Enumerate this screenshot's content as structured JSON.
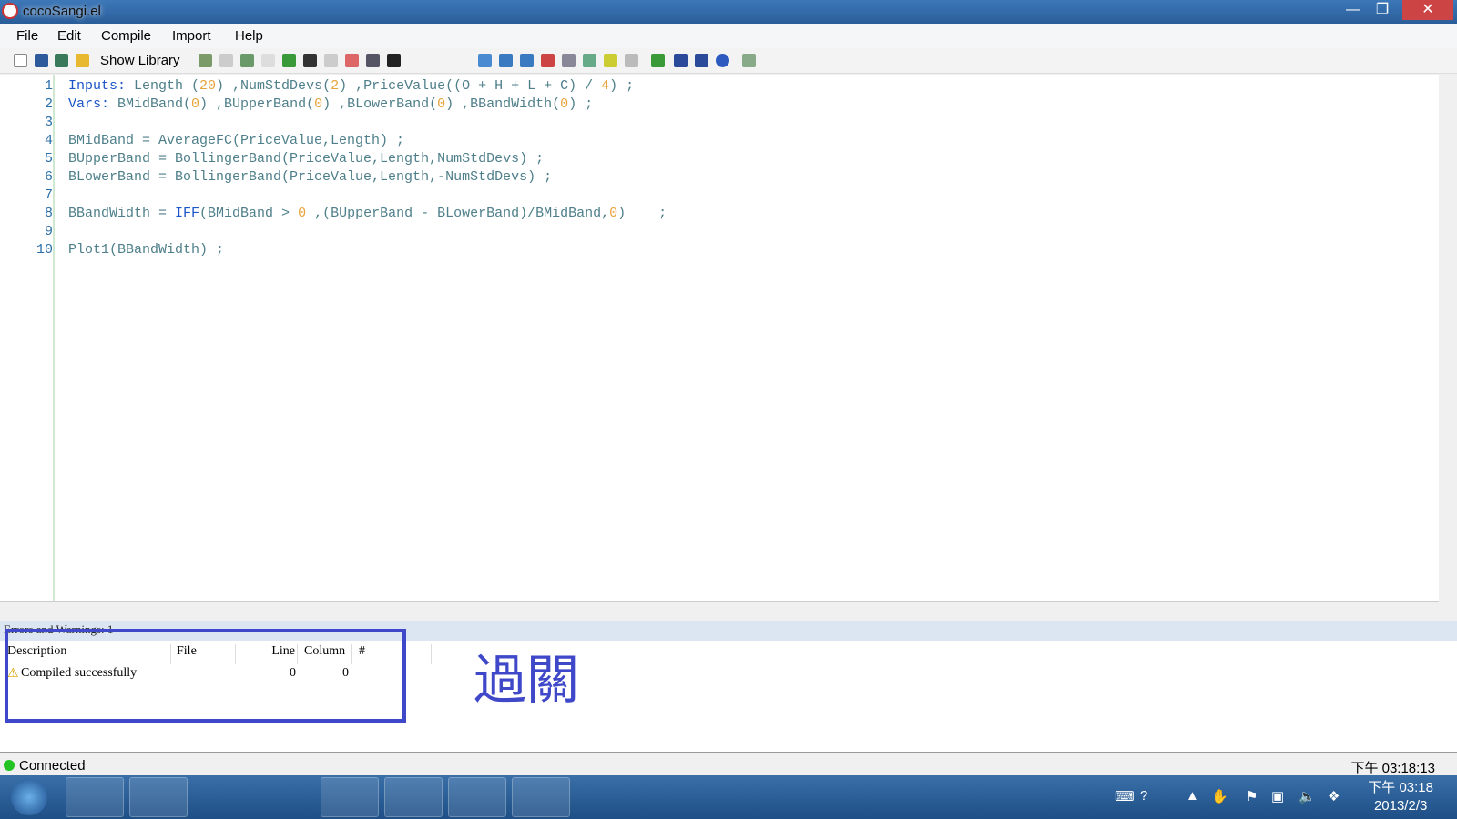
{
  "window": {
    "title": "cocoSangi.el"
  },
  "menu": [
    "File",
    "Edit",
    "Compile",
    "Import",
    "Help"
  ],
  "toolbar": {
    "show_library": "Show Library"
  },
  "code": [
    {
      "num": "1",
      "tokens": [
        [
          "k",
          "Inputs:"
        ],
        [
          "p",
          " Length ("
        ],
        [
          "n",
          "20"
        ],
        [
          "p",
          ") ,NumStdDevs("
        ],
        [
          "n",
          "2"
        ],
        [
          "p",
          ") ,PriceValue((O + H + L + C) / "
        ],
        [
          "n",
          "4"
        ],
        [
          "p",
          ") ;"
        ]
      ]
    },
    {
      "num": "2",
      "tokens": [
        [
          "k",
          "Vars:"
        ],
        [
          "p",
          " BMidBand("
        ],
        [
          "n",
          "0"
        ],
        [
          "p",
          ") ,BUpperBand("
        ],
        [
          "n",
          "0"
        ],
        [
          "p",
          ") ,BLowerBand("
        ],
        [
          "n",
          "0"
        ],
        [
          "p",
          ") ,BBandWidth("
        ],
        [
          "n",
          "0"
        ],
        [
          "p",
          ") ;"
        ]
      ]
    },
    {
      "num": "3",
      "tokens": []
    },
    {
      "num": "4",
      "tokens": [
        [
          "p",
          "BMidBand = AverageFC(PriceValue,Length) ;"
        ]
      ]
    },
    {
      "num": "5",
      "tokens": [
        [
          "p",
          "BUpperBand = BollingerBand(PriceValue,Length,NumStdDevs) ;"
        ]
      ]
    },
    {
      "num": "6",
      "tokens": [
        [
          "p",
          "BLowerBand = BollingerBand(PriceValue,Length,-NumStdDevs) ;"
        ]
      ]
    },
    {
      "num": "7",
      "tokens": []
    },
    {
      "num": "8",
      "tokens": [
        [
          "p",
          "BBandWidth = "
        ],
        [
          "k",
          "IFF"
        ],
        [
          "p",
          "(BMidBand > "
        ],
        [
          "n",
          "0"
        ],
        [
          "p",
          " ,(BUpperBand - BLowerBand)/BMidBand,"
        ],
        [
          "n",
          "0"
        ],
        [
          "p",
          ")    ;"
        ]
      ]
    },
    {
      "num": "9",
      "tokens": []
    },
    {
      "num": "10",
      "tokens": [
        [
          "p",
          "Plot1(BBandWidth) ;"
        ]
      ]
    }
  ],
  "errors": {
    "header": "Errors and Warnings: 1",
    "columns": [
      "Description",
      "File",
      "Line",
      "Column",
      "#"
    ],
    "rows": [
      {
        "description": "Compiled successfully",
        "file": "",
        "line": "0",
        "column": "0",
        "num": ""
      }
    ]
  },
  "annotation": "過關",
  "annotation_color": "#3f48c8",
  "status": {
    "connection": "Connected",
    "time": "下午 03:18:13",
    "indicator_color": "#22c322"
  },
  "taskbar": {
    "clock_time": "下午 03:18",
    "clock_date": "2013/2/3"
  }
}
